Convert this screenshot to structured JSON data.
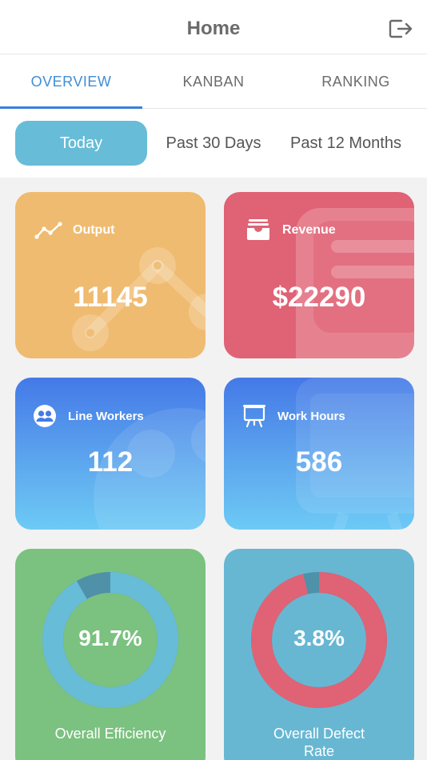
{
  "header": {
    "title": "Home",
    "logout_icon": "logout-icon"
  },
  "tabs": [
    {
      "label": "OVERVIEW",
      "active": true
    },
    {
      "label": "KANBAN",
      "active": false
    },
    {
      "label": "RANKING",
      "active": false
    }
  ],
  "periods": [
    {
      "label": "Today",
      "active": true
    },
    {
      "label": "Past 30 Days",
      "active": false
    },
    {
      "label": "Past 12 Months",
      "active": false
    }
  ],
  "cards": {
    "output": {
      "label": "Output",
      "value": "11145",
      "icon": "trend-line-icon",
      "color": "#efbb70"
    },
    "revenue": {
      "label": "Revenue",
      "value": "$22290",
      "icon": "inbox-tray-icon",
      "color": "#e06275"
    },
    "workers": {
      "label": "Line Workers",
      "value": "112",
      "icon": "users-group-icon",
      "color": "#4479e7"
    },
    "hours": {
      "label": "Work Hours",
      "value": "586",
      "icon": "presentation-board-icon",
      "color": "#4479e7"
    }
  },
  "gauges": {
    "efficiency": {
      "value": "91.7%",
      "fraction": 0.917,
      "label_line1": "Overall Efficiency",
      "label_line2": "",
      "ring_color": "#67bcd8",
      "remainder_color": "#4f91a8",
      "card_color": "#7bc180"
    },
    "defect": {
      "value": "3.8%",
      "fraction": 0.962,
      "label_line1": "Overall Defect",
      "label_line2": "Rate",
      "ring_color": "#e06275",
      "remainder_color": "#4f91a8",
      "card_color": "#67b7d3"
    }
  }
}
